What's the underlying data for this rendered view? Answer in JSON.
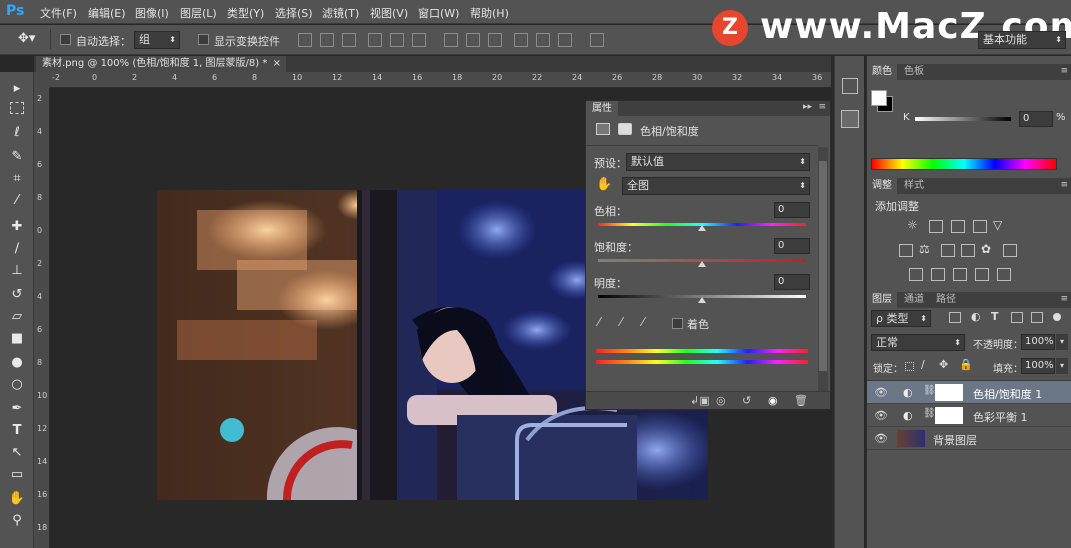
{
  "app": {
    "logo": "Ps"
  },
  "menu": [
    "文件(F)",
    "编辑(E)",
    "图像(I)",
    "图层(L)",
    "类型(Y)",
    "选择(S)",
    "滤镜(T)",
    "视图(V)",
    "窗口(W)",
    "帮助(H)"
  ],
  "options": {
    "auto_select_label": "自动选择：",
    "auto_select_value": "组",
    "show_transform_label": "显示变换控件",
    "workspace": "基本功能"
  },
  "watermark": {
    "letter": "Z",
    "text": "www.MacZ.com"
  },
  "document": {
    "tab_title": "素材.png @ 100% (色相/饱和度 1, 图层蒙版/8) *",
    "close": "×"
  },
  "ruler": {
    "top": [
      "-2",
      "0",
      "2",
      "4",
      "6",
      "8",
      "10",
      "12",
      "14",
      "16",
      "18",
      "20",
      "22",
      "24",
      "26",
      "28",
      "30",
      "32",
      "34",
      "36"
    ],
    "left": [
      "2",
      "4",
      "6",
      "8",
      "0",
      "2",
      "4",
      "6",
      "8",
      "10",
      "12",
      "14",
      "16",
      "18"
    ]
  },
  "properties": {
    "tab": "属性",
    "title": "色相/饱和度",
    "preset_label": "预设：",
    "preset_value": "默认值",
    "channel_value": "全图",
    "hue_label": "色相：",
    "hue_value": "0",
    "saturation_label": "饱和度：",
    "saturation_value": "0",
    "lightness_label": "明度：",
    "lightness_value": "0",
    "colorize_label": "着色"
  },
  "color_panel": {
    "tabs": [
      "颜色",
      "色板"
    ],
    "channel": "K",
    "value": "0",
    "unit": "%"
  },
  "adjustments_panel": {
    "tabs": [
      "调整",
      "样式"
    ],
    "title": "添加调整"
  },
  "layers_panel": {
    "tabs": [
      "图层",
      "通道",
      "路径"
    ],
    "filter_label": "ρ 类型",
    "blend_mode": "正常",
    "opacity_label": "不透明度：",
    "opacity_value": "100%",
    "lock_label": "锁定：",
    "fill_label": "填充：",
    "fill_value": "100%",
    "layers": [
      {
        "name": "色相/饱和度 1",
        "selected": true
      },
      {
        "name": "色彩平衡 1",
        "selected": false
      },
      {
        "name": "背景图层",
        "selected": false
      }
    ]
  }
}
